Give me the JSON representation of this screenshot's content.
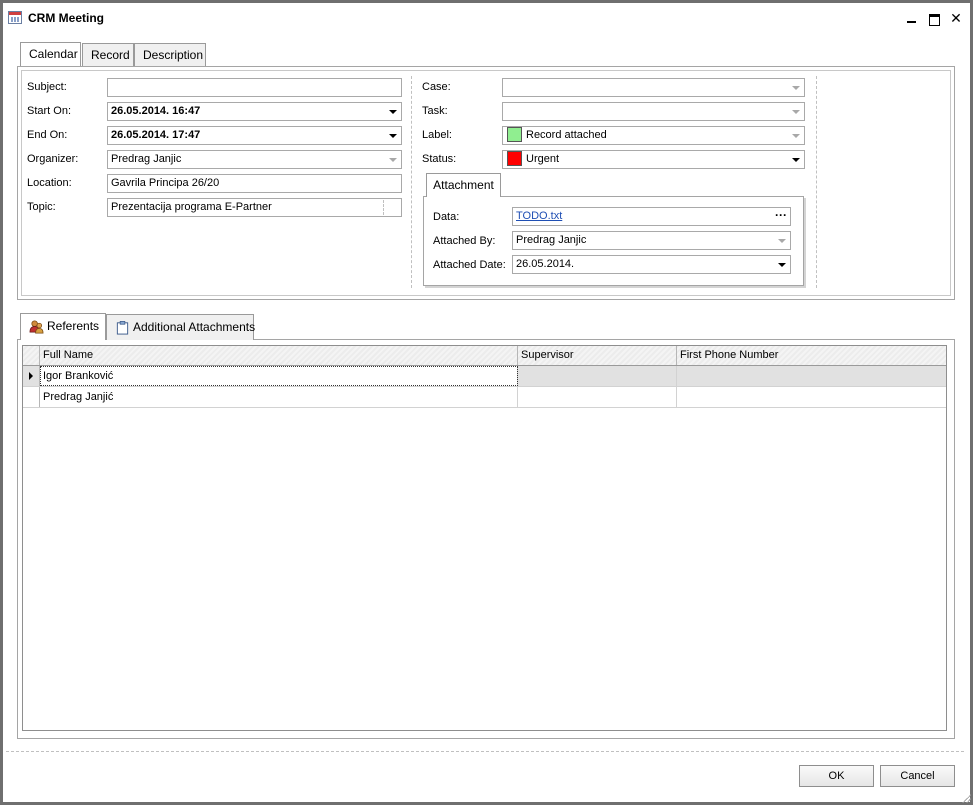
{
  "window": {
    "title": "CRM Meeting"
  },
  "top_tabs": [
    "Calendar",
    "Record",
    "Description"
  ],
  "left_fields": {
    "subject": {
      "label": "Subject:",
      "value": ""
    },
    "start_on": {
      "label": "Start On:",
      "value": "26.05.2014. 16:47"
    },
    "end_on": {
      "label": "End On:",
      "value": "26.05.2014. 17:47"
    },
    "organizer": {
      "label": "Organizer:",
      "value": "Predrag Janjic"
    },
    "location": {
      "label": "Location:",
      "value": "Gavrila Principa 26/20"
    },
    "topic": {
      "label": "Topic:",
      "value": "Prezentacija programa E-Partner"
    }
  },
  "right_fields": {
    "case": {
      "label": "Case:",
      "value": ""
    },
    "task": {
      "label": "Task:",
      "value": ""
    },
    "label": {
      "label": "Label:",
      "value": "Record attached",
      "color": "#90ee90"
    },
    "status": {
      "label": "Status:",
      "value": "Urgent",
      "color": "#ff0000"
    }
  },
  "attachment": {
    "tab": "Attachment",
    "data": {
      "label": "Data:",
      "value": "TODO.txt",
      "button": "···"
    },
    "attached_by": {
      "label": "Attached By:",
      "value": "Predrag Janjic"
    },
    "attached_date": {
      "label": "Attached Date:",
      "value": "26.05.2014."
    }
  },
  "bottom_tabs": [
    "Referents",
    "Additional Attachments"
  ],
  "grid": {
    "columns": [
      "Full Name",
      "Supervisor",
      "First Phone Number"
    ],
    "rows": [
      [
        "Igor Branković",
        "",
        ""
      ],
      [
        "Predrag  Janjić",
        "",
        ""
      ]
    ]
  },
  "buttons": {
    "ok": "OK",
    "cancel": "Cancel"
  }
}
